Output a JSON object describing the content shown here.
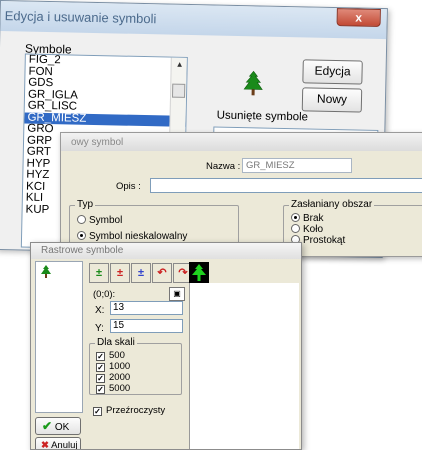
{
  "main_window": {
    "title": "Edycja i usuwanie symboli",
    "close_glyph": "x",
    "symbols_label": "Symbole",
    "symbols": [
      "FIG_2",
      "FON",
      "GDS",
      "GR_IGLA",
      "GR_LISC",
      "GR_MIESZ",
      "GRO",
      "GRP",
      "GRT",
      "HYP",
      "HYZ",
      "KCI",
      "KLI",
      "KUP"
    ],
    "selected_index": 5,
    "edit_button": "Edycja",
    "new_button": "Nowy",
    "deleted_label": "Usunięte symbole"
  },
  "new_symbol_window": {
    "title": "owy symbol",
    "name_label": "Nazwa :",
    "name_value": "GR_MIESZ",
    "desc_label": "Opis :",
    "desc_value": "",
    "type_group": "Typ",
    "type_options": [
      "Symbol",
      "Symbol nieskalowalny"
    ],
    "type_selected": 1,
    "cover_group": "Zasłaniany obszar",
    "cover_options": [
      "Brak",
      "Koło",
      "Prostokąt"
    ],
    "cover_selected": 0
  },
  "raster_window": {
    "title": "Rastrowe symbole",
    "coords": "(0;0):",
    "x_label": "X:",
    "x_value": "13",
    "y_label": "Y:",
    "y_value": "15",
    "scales_group": "Dla skali",
    "scales": [
      "500",
      "1000",
      "2000",
      "5000"
    ],
    "transparent_label": "Przeźroczysty",
    "ok_button": "OK",
    "cancel_button": "Anuluj"
  },
  "colors": {
    "accent_selection": "#316ac5",
    "tree_green": "#1a8a1a",
    "close_red": "#c24a35",
    "canvas_green": "#1fd21f"
  }
}
